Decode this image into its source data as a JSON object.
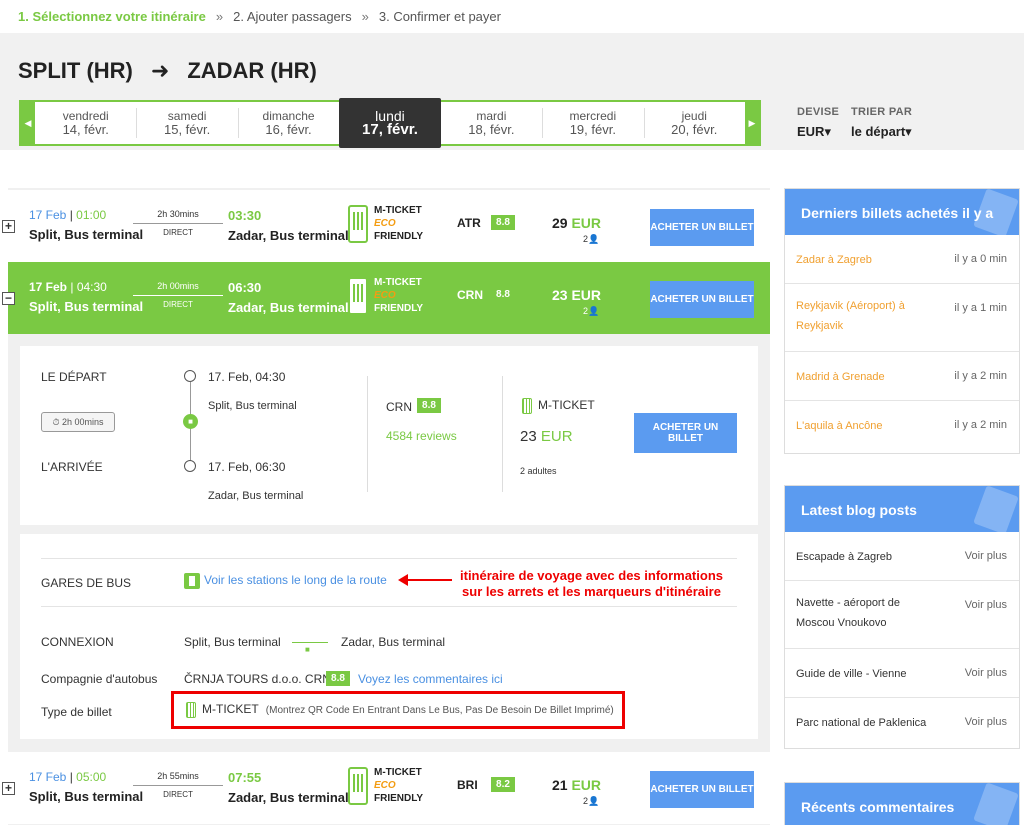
{
  "breadcrumb": {
    "step1": "1. Sélectionnez votre itinéraire",
    "step2": "2. Ajouter passagers",
    "step3": "3. Confirmer et payer",
    "sep": "»"
  },
  "route": {
    "from": "SPLIT (HR)",
    "arrow": "➜",
    "to": "ZADAR (HR)"
  },
  "dates": [
    {
      "day": "vendredi",
      "date": "14, févr."
    },
    {
      "day": "samedi",
      "date": "15, févr."
    },
    {
      "day": "dimanche",
      "date": "16, févr."
    },
    {
      "day": "lundi",
      "date": "17, févr."
    },
    {
      "day": "mardi",
      "date": "18, févr."
    },
    {
      "day": "mercredi",
      "date": "19, févr."
    },
    {
      "day": "jeudi",
      "date": "20, févr."
    }
  ],
  "date_nav": {
    "prev": "◀",
    "next": "▶"
  },
  "options": {
    "currency_label": "DEVISE",
    "currency_value": "EUR▾",
    "sort_label": "TRIER PAR",
    "sort_value": "le départ▾"
  },
  "common": {
    "direct": "DIRECT",
    "mticket1": "M-TICKET",
    "mticket2": "ECO",
    "mticket3": "FRIENDLY",
    "buy": "ACHETER UN BILLET",
    "plus": "+",
    "minus": "−",
    "pax_icon": "2👤"
  },
  "trips": [
    {
      "date": "17 Feb",
      "sep": " | ",
      "dep": "01:00",
      "from": "Split, Bus terminal",
      "dur": "2h 30mins",
      "arr": "03:30",
      "to": "Zadar, Bus terminal",
      "company": "ATR",
      "rating": "8.8",
      "price": "29",
      "cur": "EUR"
    },
    {
      "date": "17 Feb",
      "sep": " | ",
      "dep": "04:30",
      "from": "Split, Bus terminal",
      "dur": "2h 00mins",
      "arr": "06:30",
      "to": "Zadar, Bus terminal",
      "company": "CRN",
      "rating": "8.8",
      "price": "23",
      "cur": "EUR"
    },
    {
      "date": "17 Feb",
      "sep": " | ",
      "dep": "05:00",
      "from": "Split, Bus terminal",
      "dur": "2h 55mins",
      "arr": "07:55",
      "to": "Zadar, Bus terminal",
      "company": "BRI",
      "rating": "8.2",
      "price": "21",
      "cur": "EUR"
    }
  ],
  "detail": {
    "depart_label": "LE DÉPART",
    "arrival_label": "L'ARRIVÉE",
    "duration": "⏱ 2h 00mins",
    "dep_time": "17. Feb, 04:30",
    "dep_station": "Split, Bus terminal",
    "arr_time": "17. Feb, 06:30",
    "arr_station": "Zadar, Bus terminal",
    "company": "CRN",
    "rating": "8.8",
    "reviews": "4584 reviews",
    "mticket": "M-TICKET",
    "price": "23",
    "cur": "EUR",
    "adults": "2 adultes",
    "buy": "ACHETER UN BILLET"
  },
  "info": {
    "gares_label": "GARES DE BUS",
    "gares_link": "Voir les stations le long de la route",
    "annotation1": "itinéraire de voyage avec des informations",
    "annotation2": "sur les arrets et les marqueurs d'itinéraire",
    "connexion_label": "CONNEXION",
    "conn_from": "Split, Bus terminal",
    "conn_to": "Zadar, Bus terminal",
    "compagnie_label": "Compagnie d'autobus",
    "compagnie_value": "ČRNJA TOURS d.o.o. CRN",
    "compagnie_rating": "8.8",
    "compagnie_link": "Voyez les commentaires ici",
    "type_label": "Type de billet",
    "type_value": "M-TICKET",
    "type_note": "(Montrez QR Code En Entrant Dans Le Bus, Pas De Besoin De Billet Imprimé)"
  },
  "sidebar": {
    "recent_title": "Derniers billets achetés il y a",
    "recent": [
      {
        "route": "Zadar à Zagreb",
        "ago": "il y a 0 min"
      },
      {
        "route": "Reykjavik (Aéroport) à Reykjavik",
        "ago": "il y a 1 min"
      },
      {
        "route": "Madrid à Grenade",
        "ago": "il y a 2 min"
      },
      {
        "route": "L'aquila à Ancône",
        "ago": "il y a 2 min"
      }
    ],
    "blog_title": "Latest blog posts",
    "blog": [
      {
        "title": "Escapade à Zagreb",
        "more": "Voir plus"
      },
      {
        "title": "Navette - aéroport de Moscou Vnoukovo",
        "more": "Voir plus"
      },
      {
        "title": "Guide de ville - Vienne",
        "more": "Voir plus"
      },
      {
        "title": "Parc national de Paklenica",
        "more": "Voir plus"
      }
    ],
    "comments_title": "Récents commentaires"
  },
  "colors": {
    "green": "#7ac943",
    "blue": "#5b9bf0",
    "link": "#4a90e2",
    "orange": "#f0a030",
    "red": "#ee0000"
  }
}
